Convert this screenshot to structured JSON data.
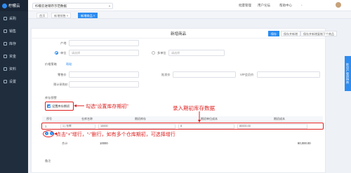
{
  "app": {
    "name": "柠檬云",
    "store": "柠檬云进销存示范数据"
  },
  "sidebar": {
    "items": [
      {
        "label": "采购"
      },
      {
        "label": "销售"
      },
      {
        "label": "库存"
      },
      {
        "label": "资金"
      },
      {
        "label": "资料"
      },
      {
        "label": "设置"
      }
    ]
  },
  "topbar": {
    "links": [
      "批量管理",
      "用户论坛",
      "帮助中心"
    ]
  },
  "tabs": [
    {
      "label": "首页"
    },
    {
      "label": "新增销售 ×"
    },
    {
      "label": "新增商品 ×"
    }
  ],
  "page": {
    "title": "新增商品",
    "buttons": [
      "保存",
      "保存并新增",
      "保存并新增复制下个商品"
    ]
  },
  "form": {
    "field_chandi": "产地",
    "unit_single_label": "单位",
    "unit_single_placeholder": "请选择",
    "unit_multi_label": "多单位",
    "unit_multi_placeholder": "请选择",
    "price_section": "价格策略",
    "price_help": "帮助",
    "retail_label": "零售价",
    "wholesale_label": "批发价",
    "vip_label": "VIP会员价",
    "purchase_label": "预计采购价",
    "stock_warning": "库存预警",
    "set_initial_stock": "设置库存期初"
  },
  "annotations": {
    "check_note": "勾选“设置库存期初”",
    "input_note": "录入期初库存数据",
    "plusminus_note": "点击“+”增行，“-”删行，如有多个仓库期初，可选择增行"
  },
  "stock_table": {
    "columns": [
      "序号",
      "仓库名称",
      "期初库存",
      "期初单位成本",
      "期初成本"
    ],
    "rows": [
      {
        "index": "1",
        "warehouse": "1 | 仓库",
        "qty": "10000",
        "unit_cost": "8",
        "total": "80000.00"
      }
    ],
    "total_label": "合计",
    "total_qty": "10000",
    "total_cost": "80,000.00"
  },
  "remark_label": "备注",
  "side_tab": "新用户使用指南",
  "colors": {
    "primary": "#2d8cf0",
    "annotation": "#e02020",
    "sidebar": "#1f2d3d"
  }
}
